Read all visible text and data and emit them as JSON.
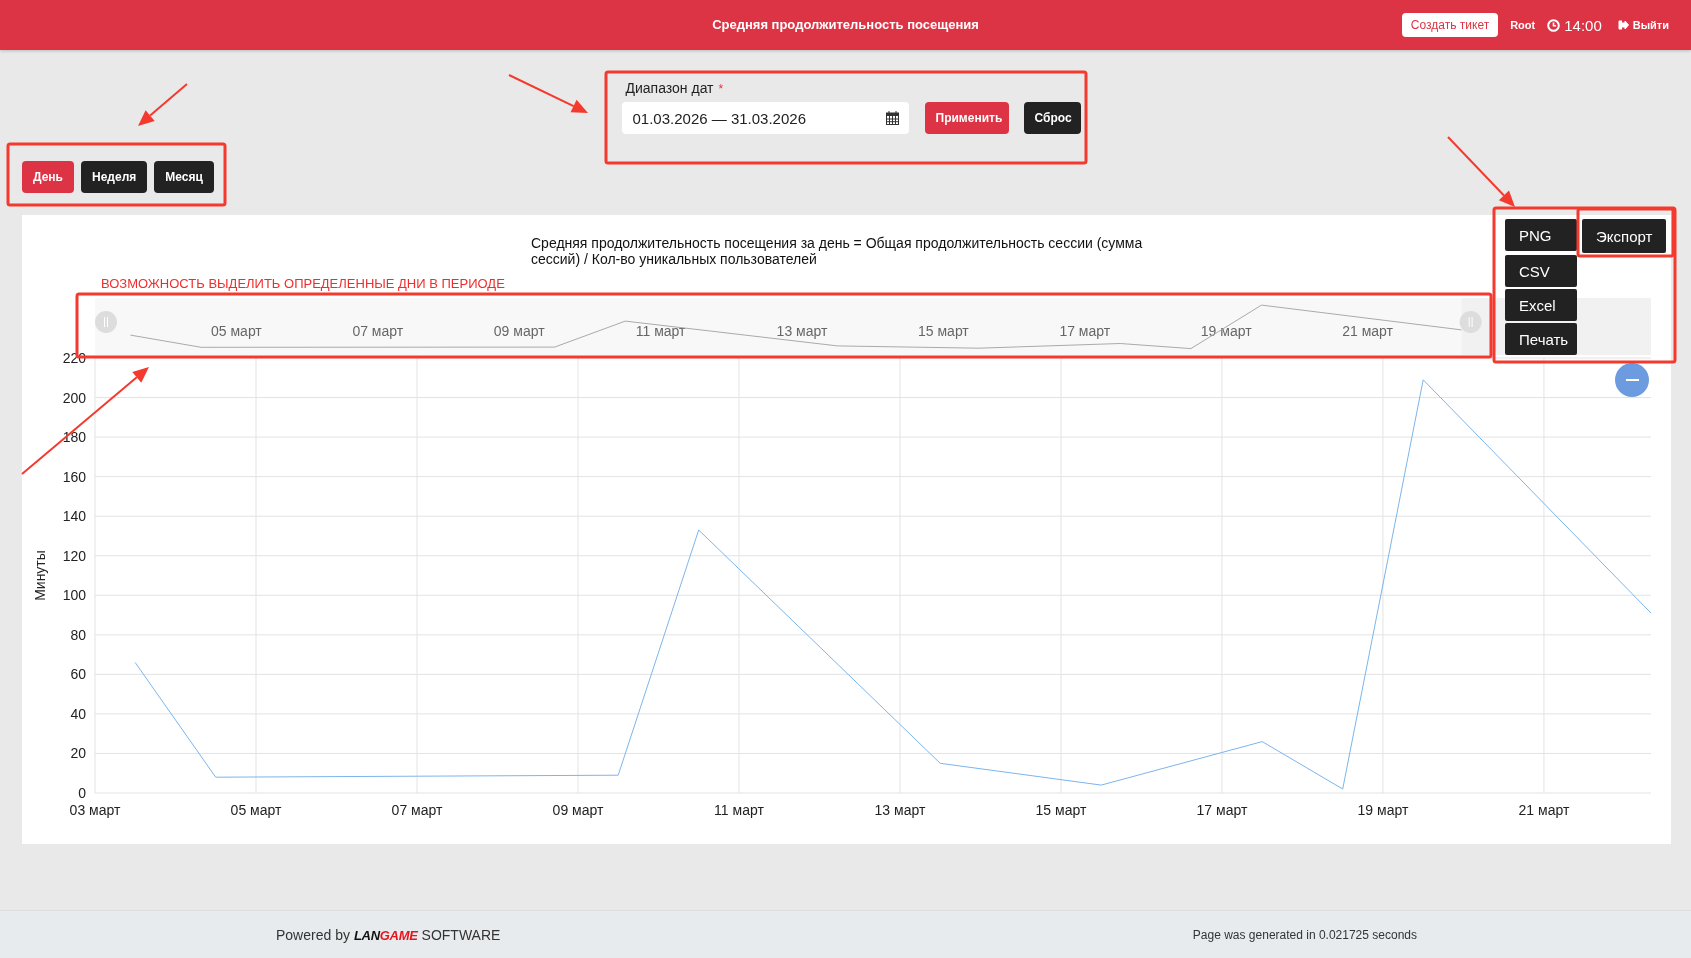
{
  "header": {
    "title": "Средняя продолжительность посещения",
    "create_ticket": "Создать тикет",
    "user": "Root",
    "time": "14:00",
    "logout": "Выйти"
  },
  "periods": [
    {
      "label": "День",
      "selected": true
    },
    {
      "label": "Неделя",
      "selected": false
    },
    {
      "label": "Месяц",
      "selected": false
    }
  ],
  "date_range": {
    "label": "Диапазон дат",
    "required_mark": "*",
    "value": "01.03.2026 — 31.03.2026",
    "buttons": [
      {
        "label": "Применить",
        "kind": "primary"
      },
      {
        "label": "Сброс",
        "kind": "secondary"
      }
    ]
  },
  "chart": {
    "title": "Средняя продолжительность посещения за день = Общая продолжительность сессии (сумма сессий) / Кол-во уникальных пользователей",
    "note": "ВОЗМОЖНОСТЬ ВЫДЕЛИТЬ ОПРЕДЕЛЕННЫЕ ДНИ В ПЕРИОДЕ",
    "navigator_labels": [
      "05 март",
      "07 март",
      "09 март",
      "11 март",
      "13 март",
      "15 март",
      "17 март",
      "19 март",
      "21 март"
    ],
    "export": {
      "button": "Экспорт",
      "items": [
        "PNG",
        "CSV",
        "Excel",
        "Печать"
      ]
    },
    "chart_data": {
      "type": "line",
      "ylabel": "Минуты",
      "x": [
        3.5,
        4.5,
        9.5,
        10.5,
        13.5,
        15.5,
        17.5,
        18.5,
        19.5,
        22.33
      ],
      "series": [
        {
          "color": "#7cb5ec",
          "values": [
            66,
            8,
            9,
            133,
            15,
            4,
            26,
            2,
            209,
            91
          ]
        }
      ],
      "grid": true,
      "xlim": [
        3,
        22.33
      ],
      "ylim": [
        0,
        220
      ],
      "xticks": [
        {
          "value": 3,
          "label": "03 март"
        },
        {
          "value": 5,
          "label": "05 март"
        },
        {
          "value": 7,
          "label": "07 март"
        },
        {
          "value": 9,
          "label": "09 март"
        },
        {
          "value": 11,
          "label": "11 март"
        },
        {
          "value": 13,
          "label": "13 март"
        },
        {
          "value": 15,
          "label": "15 март"
        },
        {
          "value": 17,
          "label": "17 март"
        },
        {
          "value": 19,
          "label": "19 март"
        },
        {
          "value": 21,
          "label": "21 март"
        }
      ],
      "yticks": [
        0,
        20,
        40,
        60,
        80,
        100,
        120,
        140,
        160,
        180,
        200,
        220
      ]
    }
  },
  "footer": {
    "powered_by": "Powered by",
    "logo_dark": "LAN",
    "logo_accent": "GAME",
    "software": "SOFTWARE",
    "generated": "Page was generated in 0.021725 seconds"
  }
}
